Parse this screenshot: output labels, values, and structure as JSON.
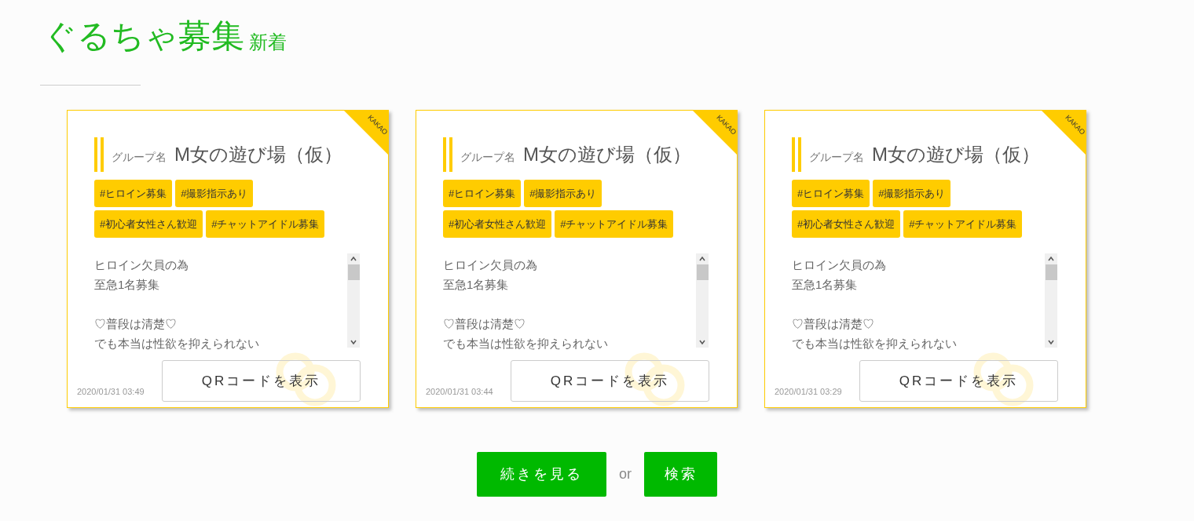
{
  "heading": {
    "title": "ぐるちゃ募集",
    "subtitle": "新着"
  },
  "cards": [
    {
      "corner": "KAKAO",
      "label": "グループ名",
      "name": "M女の遊び場（仮）",
      "tags": [
        "#ヒロイン募集",
        "#撮影指示あり",
        "#初心者女性さん歓迎",
        "#チャットアイドル募集"
      ],
      "description": [
        [
          "ヒロイン欠員の為",
          "至急1名募集"
        ],
        [
          "♡普段は清楚♡",
          "でも本当は性欲を抑えられない"
        ]
      ],
      "button": "QRコードを表示",
      "date": "2020/01/31 03:49"
    },
    {
      "corner": "KAKAO",
      "label": "グループ名",
      "name": "M女の遊び場（仮）",
      "tags": [
        "#ヒロイン募集",
        "#撮影指示あり",
        "#初心者女性さん歓迎",
        "#チャットアイドル募集"
      ],
      "description": [
        [
          "ヒロイン欠員の為",
          "至急1名募集"
        ],
        [
          "♡普段は清楚♡",
          "でも本当は性欲を抑えられない"
        ]
      ],
      "button": "QRコードを表示",
      "date": "2020/01/31 03:44"
    },
    {
      "corner": "KAKAO",
      "label": "グループ名",
      "name": "M女の遊び場（仮）",
      "tags": [
        "#ヒロイン募集",
        "#撮影指示あり",
        "#初心者女性さん歓迎",
        "#チャットアイドル募集"
      ],
      "description": [
        [
          "ヒロイン欠員の為",
          "至急1名募集"
        ],
        [
          "♡普段は清楚♡",
          "でも本当は性欲を抑えられない"
        ]
      ],
      "button": "QRコードを表示",
      "date": "2020/01/31 03:29"
    }
  ],
  "actions": {
    "more_button": "続きを見る",
    "separator": "or",
    "search_button": "検索"
  }
}
